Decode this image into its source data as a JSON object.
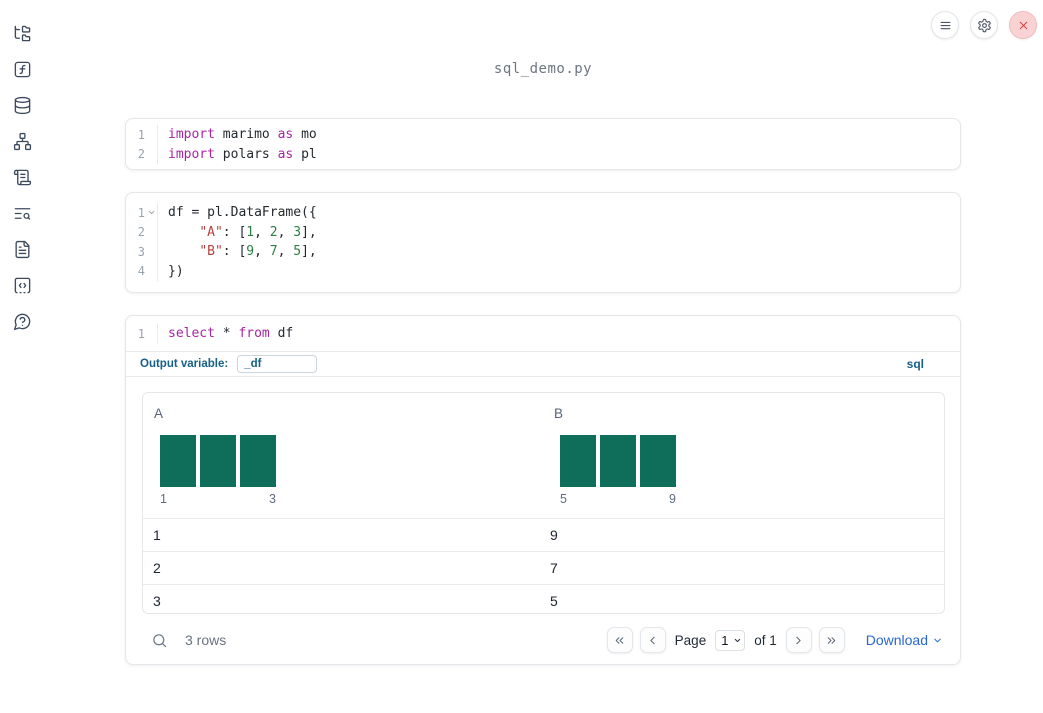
{
  "app": {
    "title": "sql_demo.py"
  },
  "topbar": {
    "icons": [
      "menu-icon",
      "settings-gear-icon",
      "close-x-icon"
    ]
  },
  "sidebar": {
    "icons": [
      "file-tree-icon",
      "function-square-icon",
      "database-icon",
      "network-icon",
      "scroll-icon",
      "list-search-icon",
      "file-text-icon",
      "code-square-icon",
      "help-bubble-icon"
    ]
  },
  "cells": [
    {
      "lines": [
        {
          "num": "1",
          "tokens": [
            [
              "import",
              "kw"
            ],
            [
              " marimo ",
              "pl"
            ],
            [
              "as",
              "kw"
            ],
            [
              " mo",
              "pl"
            ]
          ]
        },
        {
          "num": "2",
          "tokens": [
            [
              "import",
              "kw"
            ],
            [
              " polars ",
              "pl"
            ],
            [
              "as",
              "kw"
            ],
            [
              " pl",
              "pl"
            ]
          ]
        }
      ]
    },
    {
      "lines": [
        {
          "num": "1",
          "fold": true,
          "tokens": [
            [
              "df = pl.DataFrame({",
              "pl"
            ]
          ]
        },
        {
          "num": "2",
          "tokens": [
            [
              "    ",
              "pl"
            ],
            [
              "\"A\"",
              "str"
            ],
            [
              ": [",
              "pl"
            ],
            [
              "1",
              "num"
            ],
            [
              ", ",
              "pl"
            ],
            [
              "2",
              "num"
            ],
            [
              ", ",
              "pl"
            ],
            [
              "3",
              "num"
            ],
            [
              "],",
              "pl"
            ]
          ]
        },
        {
          "num": "3",
          "tokens": [
            [
              "    ",
              "pl"
            ],
            [
              "\"B\"",
              "str"
            ],
            [
              ": [",
              "pl"
            ],
            [
              "9",
              "num"
            ],
            [
              ", ",
              "pl"
            ],
            [
              "7",
              "num"
            ],
            [
              ", ",
              "pl"
            ],
            [
              "5",
              "num"
            ],
            [
              "],",
              "pl"
            ]
          ]
        },
        {
          "num": "4",
          "tokens": [
            [
              "})",
              "pl"
            ]
          ]
        }
      ]
    },
    {
      "lines": [
        {
          "num": "1",
          "tokens": [
            [
              "select",
              "kw"
            ],
            [
              " * ",
              "pl"
            ],
            [
              "from",
              "kw"
            ],
            [
              " df",
              "pl"
            ]
          ]
        }
      ]
    }
  ],
  "sql_meta": {
    "output_variable_label": "Output variable:",
    "output_variable_value": "_df",
    "language_badge": "sql"
  },
  "table": {
    "columns": [
      {
        "header": "A",
        "hist": {
          "values": [
            1,
            1,
            1
          ],
          "min_label": "1",
          "max_label": "3"
        }
      },
      {
        "header": "B",
        "hist": {
          "values": [
            1,
            1,
            1
          ],
          "min_label": "5",
          "max_label": "9"
        }
      }
    ],
    "rows": [
      [
        "1",
        "9"
      ],
      [
        "2",
        "7"
      ],
      [
        "3",
        "5"
      ]
    ],
    "footer": {
      "row_count": "3 rows",
      "page_label": "Page",
      "page_value": "1",
      "of_label": "of 1",
      "download_label": "Download"
    }
  },
  "colors": {
    "hist_bar": "#0e6e5a",
    "keyword": "#a626a4",
    "string": "#b5423e",
    "number": "#2e7d46",
    "sql_accent": "#176087",
    "download_blue": "#2767cf",
    "close_red": "#d64545"
  }
}
